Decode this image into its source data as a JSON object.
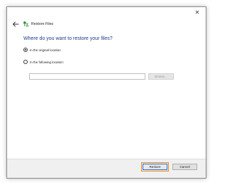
{
  "window": {
    "title": "Restore Files",
    "close_glyph": "✕",
    "back_icon": "back-arrow-icon",
    "app_icon": "restore-files-icon"
  },
  "main": {
    "heading": "Where do you want to restore your files?",
    "options": [
      {
        "label": "In the original location",
        "checked": true
      },
      {
        "label": "In the following location:",
        "checked": false
      }
    ],
    "location_input": {
      "value": "",
      "placeholder": ""
    },
    "browse_label": "Browse..."
  },
  "footer": {
    "restore_label": "Restore",
    "cancel_label": "Cancel"
  },
  "colors": {
    "heading": "#1f3a8a",
    "restore_highlight": "#f08a1c",
    "app_icon_green": "#2e8b3a"
  }
}
